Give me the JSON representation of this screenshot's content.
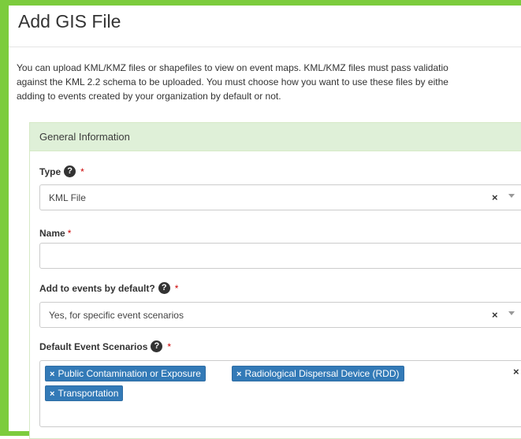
{
  "page": {
    "title": "Add GIS File",
    "intro": [
      "You can upload KML/KMZ files or shapefiles to view on event maps. KML/KMZ files must pass validatio",
      "against the KML 2.2 schema to be uploaded. You must choose how you want to use these files by eithe",
      "adding to events created by your organization by default or not."
    ]
  },
  "section": {
    "title": "General Information"
  },
  "fields": {
    "type": {
      "label": "Type",
      "required": "*",
      "help": "?",
      "value": "KML File",
      "clear": "×"
    },
    "name": {
      "label": "Name",
      "required": "*",
      "value": ""
    },
    "default": {
      "label": "Add to events by default?",
      "required": "*",
      "help": "?",
      "value": "Yes, for specific event scenarios",
      "clear": "×"
    },
    "scenarios": {
      "label": "Default Event Scenarios",
      "required": "*",
      "help": "?",
      "clear": "×",
      "tag_remove": "×",
      "tags": [
        "Public Contamination or Exposure",
        "Radiological Dispersal Device (RDD)",
        "Transportation"
      ]
    }
  },
  "colors": {
    "frame": "#7ccc3d",
    "section_header_bg": "#dff0d8",
    "tag_bg": "#337ab7",
    "required": "#cc0000"
  }
}
